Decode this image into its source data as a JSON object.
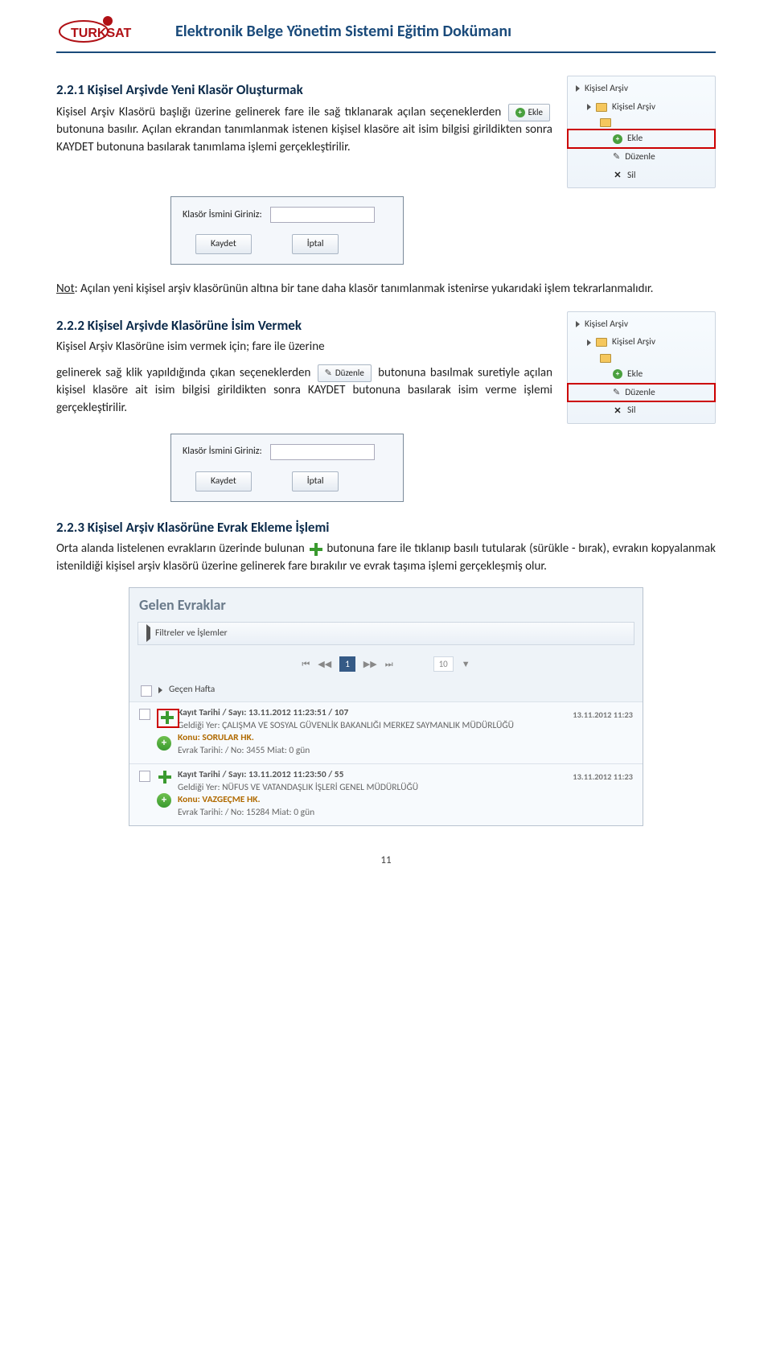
{
  "header": {
    "logo_alt": "TÜRKSAT",
    "title": "Elektronik Belge Yönetim Sistemi Eğitim Dokümanı"
  },
  "section_221": {
    "heading": "2.2.1     Kişisel Arşivde Yeni Klasör Oluşturmak",
    "p1a": "Kişisel Arşiv Klasörü başlığı üzerine gelinerek fare ile sağ tıklanarak açılan seçeneklerden",
    "btn_ekle": "Ekle",
    "p1b": "butonuna basılır. Açılan ekrandan tanımlanmak istenen kişisel klasöre ait isim bilgisi girildikten sonra KAYDET butonuna basılarak tanımlama işlemi gerçekleştirilir."
  },
  "menu1": {
    "root": "Kişisel Arşiv",
    "child": "Kişisel Arşiv",
    "ekle": "Ekle",
    "duzenle": "Düzenle",
    "sil": "Sil"
  },
  "dialog": {
    "label": "Klasör İsmini Giriniz:",
    "save": "Kaydet",
    "cancel": "İptal"
  },
  "note": {
    "label": "Not",
    "text": ": Açılan yeni kişisel arşiv klasörünün altına bir tane daha klasör tanımlanmak istenirse yukarıdaki işlem tekrarlanmalıdır."
  },
  "section_222": {
    "heading": "2.2.2   Kişisel Arşivde Klasörüne İsim Vermek",
    "p1": "Kişisel Arşiv Klasörüne isim vermek için; fare ile üzerine",
    "p2a": "gelinerek sağ klik yapıldığında çıkan seçeneklerden",
    "btn_duzenle": "Düzenle",
    "p2b": "butonuna basılmak suretiyle açılan kişisel klasöre ait isim bilgisi girildikten sonra KAYDET butonuna basılarak isim verme işlemi gerçekleştirilir."
  },
  "section_223": {
    "heading": "2.2.3   Kişisel Arşiv Klasörüne Evrak Ekleme İşlemi",
    "p1a": "Orta alanda listelenen evrakların üzerinde bulunan",
    "p1b": "butonuna fare ile tıklanıp basılı tutularak (sürükle - bırak), evrakın kopyalanmak istenildiği kişisel arşiv klasörü üzerine gelinerek fare bırakılır ve evrak taşıma işlemi gerçekleşmiş olur."
  },
  "gelen": {
    "title": "Gelen Evraklar",
    "filter": "Filtreler ve İşlemler",
    "page_1": "1",
    "page_size": "10",
    "week": "Geçen Hafta",
    "rows": [
      {
        "kayit": "Kayıt Tarihi / Sayı: 13.11.2012 11:23:51 / 107",
        "geldigi": "Geldiği Yer: ÇALIŞMA VE SOSYAL GÜVENLİK BAKANLIĞI MERKEZ SAYMANLIK MÜDÜRLÜĞÜ",
        "konu": "Konu: SORULAR HK.",
        "evrak": "Evrak Tarihi: / No: 3455 Miat: 0 gün",
        "time": "13.11.2012 11:23",
        "highlight": true
      },
      {
        "kayit": "Kayıt Tarihi / Sayı: 13.11.2012 11:23:50 / 55",
        "geldigi": "Geldiği Yer: NÜFUS VE VATANDAŞLIK İŞLERİ GENEL MÜDÜRLÜĞÜ",
        "konu": "Konu: VAZGEÇME HK.",
        "evrak": "Evrak Tarihi: / No: 15284 Miat: 0 gün",
        "time": "13.11.2012 11:23",
        "highlight": false
      }
    ]
  },
  "page_number": "11"
}
